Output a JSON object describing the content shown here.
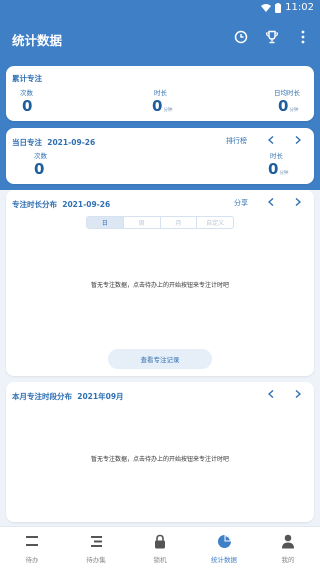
{
  "status_bar": {
    "time": "11:02"
  },
  "app_bar": {
    "title": "统计数据"
  },
  "total": {
    "title": "累计专注",
    "count_label": "次数",
    "count_value": "0",
    "duration_label": "时长",
    "duration_value": "0",
    "duration_unit": "分钟",
    "daily_avg_label": "日均时长",
    "daily_avg_value": "0",
    "daily_avg_unit": "分钟"
  },
  "today": {
    "title": "当日专注",
    "date": "2021-09-26",
    "rank_link": "排行榜",
    "count_label": "次数",
    "count_value": "0",
    "duration_label": "时长",
    "duration_value": "0",
    "duration_unit": "分钟"
  },
  "distribution": {
    "title": "专注时长分布",
    "date": "2021-09-26",
    "share_link": "分享",
    "tabs": [
      {
        "label": "日",
        "active": true
      },
      {
        "label": "周",
        "active": false
      },
      {
        "label": "月",
        "active": false
      },
      {
        "label": "自定义",
        "active": false
      }
    ],
    "empty_text": "暂无专注数据，点击待办上的开始按钮来专注计时吧",
    "view_records_button": "查看专注记录"
  },
  "monthly": {
    "title": "本月专注时段分布",
    "month": "2021年09月",
    "empty_text": "暂无专注数据，点击待办上的开始按钮来专注计时吧"
  },
  "bottom_nav": [
    {
      "label": "待办",
      "icon": "todo-list-icon",
      "active": false
    },
    {
      "label": "待办集",
      "icon": "todo-collection-icon",
      "active": false
    },
    {
      "label": "锁机",
      "icon": "lock-icon",
      "active": false
    },
    {
      "label": "统计数据",
      "icon": "pie-chart-icon",
      "active": true
    },
    {
      "label": "我的",
      "icon": "person-icon",
      "active": false
    }
  ],
  "colors": {
    "primary": "#3f7fc6",
    "accent_text": "#2f6fb2",
    "number": "#1d5e9f",
    "background": "#eef3f9"
  }
}
